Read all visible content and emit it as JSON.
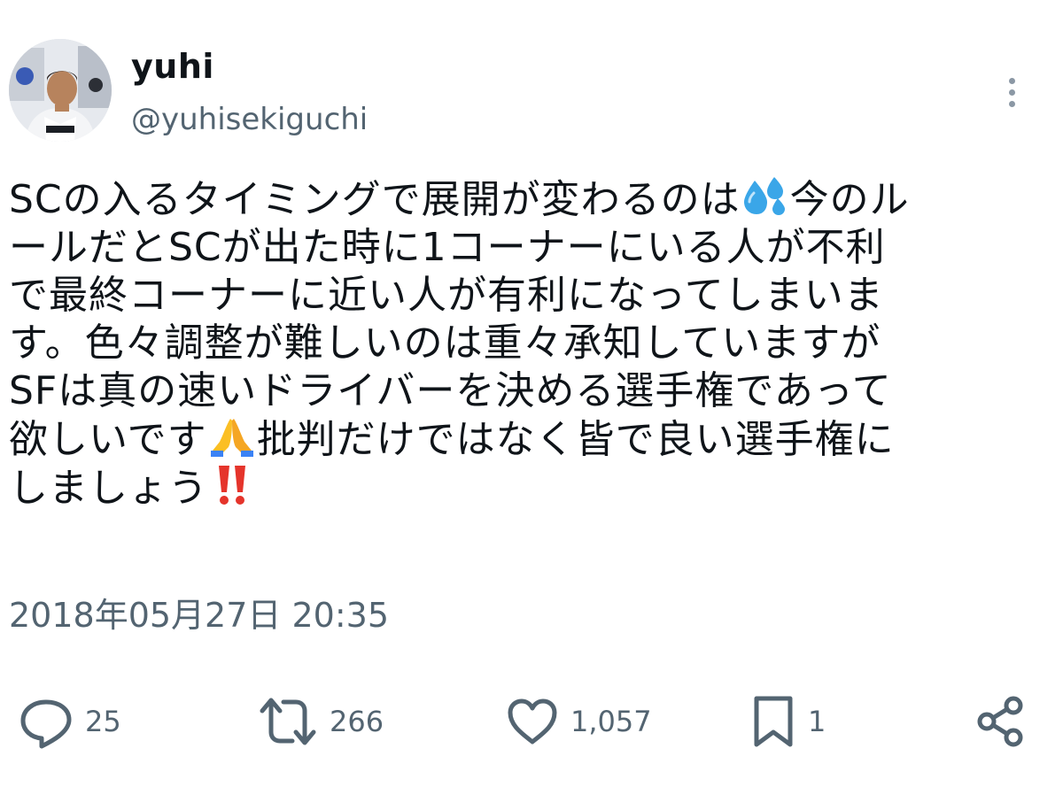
{
  "user": {
    "display_name": "yuhi",
    "handle": "@yuhisekiguchi"
  },
  "tweet": {
    "lines": [
      [
        "SCの入るタイミングで展開が変わるのは",
        "sweat-droplets-emoji",
        "今のル"
      ],
      [
        "ールだとSCが出た時に1コーナーにいる人が不利"
      ],
      [
        "で最終コーナーに近い人が有利になってしまいま"
      ],
      [
        "す。色々調整が難しいのは重々承知していますが"
      ],
      [
        "SFは真の速いドライバーを決める選手権であって"
      ],
      [
        "欲しいです",
        "folded-hands-emoji",
        "批判だけではなく皆で良い選手権に"
      ],
      [
        "しましょう",
        "double-exclamation-emoji"
      ]
    ],
    "line_1_a": "SCの入るタイミングで展開が変わるのは",
    "line_1_b": "今のル",
    "line_2": "ールだとSCが出た時に1コーナーにいる人が不利",
    "line_3": "で最終コーナーに近い人が有利になってしまいま",
    "line_4": "す。色々調整が難しいのは重々承知していますが",
    "line_5": "SFは真の速いドライバーを決める選手権であって",
    "line_6_a": "欲しいです",
    "line_6_b": "批判だけではなく皆で良い選手権に",
    "line_7": "しましょう",
    "timestamp": "2018年05月27日 20:35"
  },
  "actions": {
    "reply_count": "25",
    "retweet_count": "266",
    "like_count": "1,057",
    "bookmark_count": "1"
  },
  "icons": {
    "more": "more-vertical-icon",
    "reply": "reply-icon",
    "retweet": "retweet-icon",
    "like": "heart-icon",
    "bookmark": "bookmark-icon",
    "share": "share-icon"
  },
  "colors": {
    "text": "#0f1419",
    "secondary": "#536471",
    "icon": "#536471"
  }
}
